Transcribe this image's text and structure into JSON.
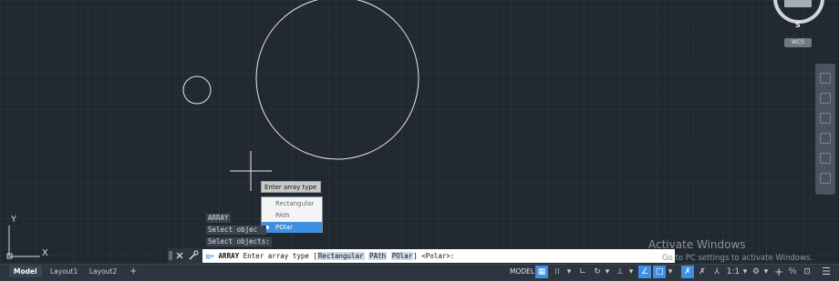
{
  "viewcube": {
    "south_label": "S",
    "wcs_label": "WCS"
  },
  "drawing": {
    "ucs_y_label": "Y",
    "ucs_x_label": "X"
  },
  "dynamic_input": {
    "prompt": "Enter array type",
    "options": [
      "Rectangular",
      "PAth",
      "POlar"
    ],
    "selected_option": "POlar"
  },
  "command_history": [
    "ARRAY",
    "Select objec",
    "Select objects:"
  ],
  "command_line": {
    "command": "ARRAY",
    "prompt_prefix": "Enter array type [",
    "opt1": "Rectangular",
    "opt2": "PAth",
    "opt3": "POlar",
    "prompt_suffix": "] <Polar>:"
  },
  "activate_windows": {
    "title": "Activate Windows",
    "subtitle": "Go to PC settings to activate Windows."
  },
  "layout_tabs": [
    {
      "label": "Model",
      "active": true
    },
    {
      "label": "Layout1",
      "active": false
    },
    {
      "label": "Layout2",
      "active": false
    }
  ],
  "status_bar": {
    "model_label": "MODEL",
    "scale_label": "1:1"
  },
  "colors": {
    "background": "#212830",
    "accent": "#3f8fe3"
  }
}
